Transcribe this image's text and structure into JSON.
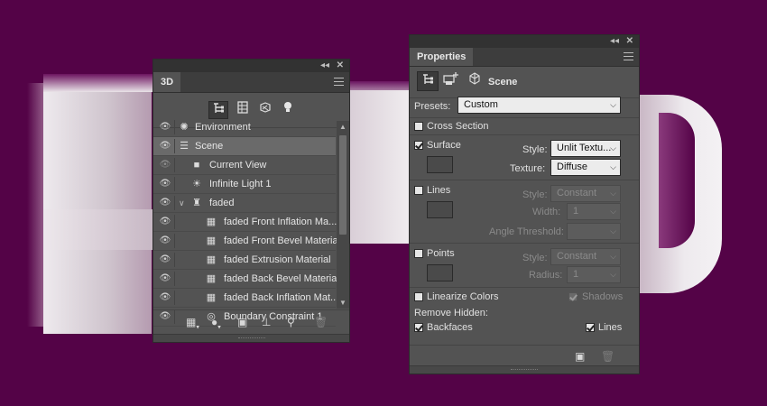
{
  "colors": {
    "canvas_bg": "#540347",
    "panel_bg": "#535353",
    "selected_row": "#6a6a6a"
  },
  "panel_3d": {
    "tab_label": "3D",
    "collapse_icon": "double-chevron-right-icon",
    "close_icon": "close-icon",
    "filter_buttons": [
      "whole-scene-icon",
      "meshes-icon",
      "materials-icon",
      "lights-icon"
    ],
    "layers": [
      {
        "label": "Environment",
        "icon": "environment-icon",
        "indent": 0
      },
      {
        "label": "Scene",
        "icon": "scene-icon",
        "indent": 0,
        "selected": true
      },
      {
        "label": "Current View",
        "icon": "camera-icon",
        "indent": 1
      },
      {
        "label": "Infinite Light 1",
        "icon": "light-icon",
        "indent": 1
      },
      {
        "label": "faded",
        "icon": "mesh-icon",
        "indent": 1,
        "expanded": true
      },
      {
        "label": "faded Front Inflation Ma...",
        "icon": "material-icon",
        "indent": 2
      },
      {
        "label": "faded Front Bevel Material",
        "icon": "material-icon",
        "indent": 2
      },
      {
        "label": "faded Extrusion Material",
        "icon": "material-icon",
        "indent": 2
      },
      {
        "label": "faded Back Bevel Material",
        "icon": "material-icon",
        "indent": 2
      },
      {
        "label": "faded Back Inflation Mat...",
        "icon": "material-icon",
        "indent": 2
      },
      {
        "label": "Boundary Constraint 1",
        "icon": "constraint-icon",
        "indent": 2
      }
    ],
    "bottom_tools": [
      "add-mesh-icon",
      "add-light-icon",
      "render-icon",
      "drop-to-ground-icon",
      "constraint-icon",
      "trash-icon"
    ]
  },
  "properties": {
    "tab_label": "Properties",
    "mode_label": "Scene",
    "presets": {
      "label": "Presets:",
      "value": "Custom"
    },
    "cross_section": {
      "label": "Cross Section",
      "checked": false
    },
    "surface": {
      "label": "Surface",
      "checked": true,
      "style_label": "Style:",
      "style_value": "Unlit Textu...",
      "texture_label": "Texture:",
      "texture_value": "Diffuse"
    },
    "lines": {
      "label": "Lines",
      "checked": false,
      "style_label": "Style:",
      "style_value": "Constant",
      "width_label": "Width:",
      "width_value": "1",
      "angle_label": "Angle Threshold:",
      "angle_value": ""
    },
    "points": {
      "label": "Points",
      "checked": false,
      "style_label": "Style:",
      "style_value": "Constant",
      "radius_label": "Radius:",
      "radius_value": "1"
    },
    "linearize": {
      "label": "Linearize Colors",
      "checked": false
    },
    "shadows": {
      "label": "Shadows",
      "checked": true
    },
    "remove_hidden": {
      "label": "Remove Hidden:",
      "backfaces": {
        "label": "Backfaces",
        "checked": true
      },
      "lines": {
        "label": "Lines",
        "checked": true
      }
    }
  }
}
